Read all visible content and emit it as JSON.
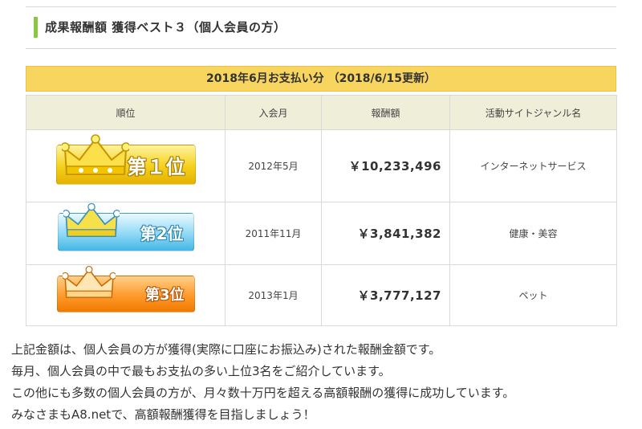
{
  "heading": {
    "title": "成果報酬額 獲得ベスト３（個人会員の方）"
  },
  "banner": {
    "text": "2018年6月お支払い分 （2018/6/15更新）"
  },
  "table": {
    "headers": [
      "順位",
      "入会月",
      "報酬額",
      "活動サイトジャンル名"
    ],
    "rows": [
      {
        "rank_label": "第１位",
        "joined": "2012年5月",
        "amount": "￥10,233,496",
        "genre": "インターネットサービス"
      },
      {
        "rank_label": "第2位",
        "joined": "2011年11月",
        "amount": "￥3,841,382",
        "genre": "健康・美容"
      },
      {
        "rank_label": "第3位",
        "joined": "2013年1月",
        "amount": "￥3,777,127",
        "genre": "ペット"
      }
    ]
  },
  "footer": {
    "lines": [
      "上記金額は、個人会員の方が獲得(実際に口座にお振込み)された報酬金額です。",
      "毎月、個人会員の中で最もお支払の多い上位3名をご紹介しています。",
      "この他にも多数の個人会員の方が、月々数十万円を超える高額報酬の獲得に成功しています。",
      "みなさまもA8.netで、高額報酬獲得を目指しましょう！"
    ]
  },
  "colors": {
    "accent_bar": "#8cc63f",
    "banner_bg": "#f7d55e",
    "header_bg": "#eeeed9",
    "gold": "#f4d11c",
    "silver_blue": "#8fd9f5",
    "bronze_orange": "#ff9a2b"
  },
  "icons": [
    "crown-gold-icon",
    "crown-silver-icon",
    "crown-bronze-icon"
  ]
}
